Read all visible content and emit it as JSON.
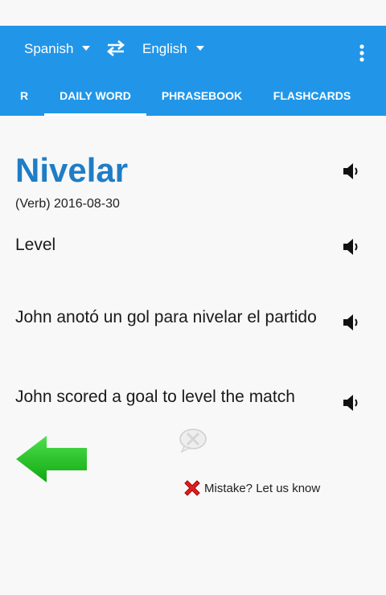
{
  "header": {
    "source_language": "Spanish",
    "target_language": "English",
    "icons": {
      "swap": "swap-arrows-icon",
      "menu": "more-vert-icon"
    }
  },
  "tabs": [
    {
      "label": "R"
    },
    {
      "label": "DAILY WORD",
      "selected": true
    },
    {
      "label": "PHRASEBOOK"
    },
    {
      "label": "FLASHCARDS"
    }
  ],
  "daily_word": {
    "word": "Nivelar",
    "meta": "(Verb) 2016-08-30",
    "translation": "Level",
    "example_source": "John anotó un gol para nivelar el partido",
    "example_target": "John scored a goal to level the match"
  },
  "actions": {
    "report_label": "Mistake? Let us know"
  },
  "colors": {
    "header_bg": "#2196e9",
    "word_color": "#1e7dc7",
    "back_arrow": "#19c219",
    "report_x": "#e02020"
  }
}
